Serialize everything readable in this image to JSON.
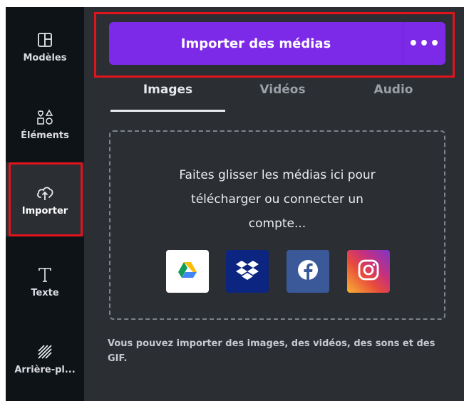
{
  "sidebar": {
    "items": [
      {
        "label": "Modèles",
        "icon": "templates-icon"
      },
      {
        "label": "Éléments",
        "icon": "elements-icon"
      },
      {
        "label": "Importer",
        "icon": "upload-cloud-icon"
      },
      {
        "label": "Texte",
        "icon": "text-icon"
      },
      {
        "label": "Arrière-pl...",
        "icon": "background-icon"
      }
    ]
  },
  "upload": {
    "button_label": "Importer des médias",
    "more_label": "•••"
  },
  "tabs": [
    {
      "label": "Images",
      "active": true
    },
    {
      "label": "Vidéos",
      "active": false
    },
    {
      "label": "Audio",
      "active": false
    }
  ],
  "dropzone": {
    "line1": "Faites glisser les médias ici pour",
    "line2": "télécharger ou connecter un",
    "line3": "compte...",
    "services": [
      "google-drive-icon",
      "dropbox-icon",
      "facebook-icon",
      "instagram-icon"
    ]
  },
  "footnote": {
    "text": "Vous pouvez importer des images, des vidéos, des sons et des GIF."
  },
  "colors": {
    "accent": "#7d2ae8",
    "highlight": "#e1141c",
    "panel": "#2b2e33",
    "sidebar": "#0e1318"
  }
}
